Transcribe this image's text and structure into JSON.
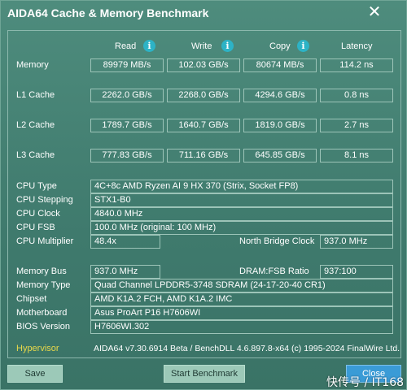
{
  "window": {
    "title": "AIDA64 Cache & Memory Benchmark",
    "close_glyph": "✕"
  },
  "columns": {
    "read": "Read",
    "write": "Write",
    "copy": "Copy",
    "latency": "Latency"
  },
  "info_icon": {
    "glyph": "i",
    "color": "#2db3c6"
  },
  "bench_rows": [
    {
      "label": "Memory",
      "read": "89979 MB/s",
      "write": "102.03 GB/s",
      "copy": "80674 MB/s",
      "latency": "114.2 ns"
    },
    {
      "label": "L1 Cache",
      "read": "2262.0 GB/s",
      "write": "2268.0 GB/s",
      "copy": "4294.6 GB/s",
      "latency": "0.8 ns"
    },
    {
      "label": "L2 Cache",
      "read": "1789.7 GB/s",
      "write": "1640.7 GB/s",
      "copy": "1819.0 GB/s",
      "latency": "2.7 ns"
    },
    {
      "label": "L3 Cache",
      "read": "777.83 GB/s",
      "write": "711.16 GB/s",
      "copy": "645.85 GB/s",
      "latency": "8.1 ns"
    }
  ],
  "cpu": {
    "type_label": "CPU Type",
    "type_value": "4C+8c AMD Ryzen AI 9 HX 370  (Strix, Socket FP8)",
    "stepping_label": "CPU Stepping",
    "stepping_value": "STX1-B0",
    "clock_label": "CPU Clock",
    "clock_value": "4840.0 MHz",
    "fsb_label": "CPU FSB",
    "fsb_value": "100.0 MHz  (original: 100 MHz)",
    "multiplier_label": "CPU Multiplier",
    "multiplier_value": "48.4x",
    "nb_clock_label": "North Bridge Clock",
    "nb_clock_value": "937.0 MHz"
  },
  "memory": {
    "bus_label": "Memory Bus",
    "bus_value": "937.0 MHz",
    "ratio_label": "DRAM:FSB Ratio",
    "ratio_value": "937:100",
    "type_label": "Memory Type",
    "type_value": "Quad Channel LPDDR5-3748 SDRAM  (24-17-20-40 CR1)",
    "chipset_label": "Chipset",
    "chipset_value": "AMD K1A.2 FCH, AMD K1A.2 IMC",
    "motherboard_label": "Motherboard",
    "motherboard_value": "Asus ProArt P16 H7606WI",
    "bios_label": "BIOS Version",
    "bios_value": "H7606WI.302"
  },
  "footer": {
    "hypervisor_label": "Hypervisor",
    "version_text": "AIDA64 v7.30.6914 Beta / BenchDLL 4.6.897.8-x64  (c) 1995-2024 FinalWire Ltd.",
    "save_label": "Save",
    "start_label": "Start Benchmark",
    "close_label": "Close"
  },
  "watermark": "快传号 / IT168",
  "colors": {
    "background": "#3f7a6d",
    "close_button": "#3a9bd6",
    "hypervisor": "#e8d84a"
  }
}
